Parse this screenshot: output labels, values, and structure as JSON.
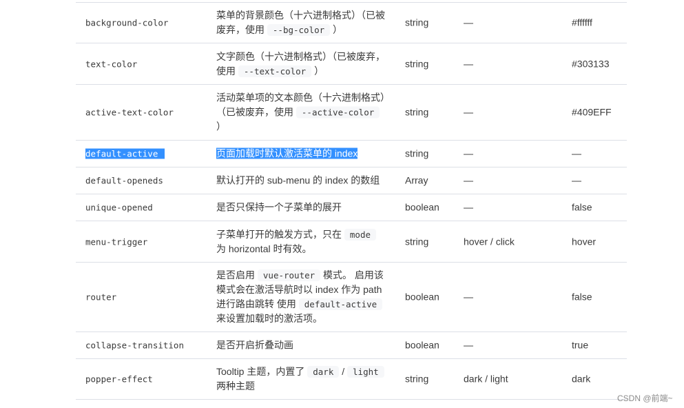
{
  "rows": [
    {
      "name": "background-color",
      "desc": [
        {
          "t": "菜单的背景颜色（十六进制格式）（已被废弃，使用 "
        },
        {
          "c": "--bg-color"
        },
        {
          "t": " ）"
        }
      ],
      "type": "string",
      "options": "—",
      "default": "#ffffff"
    },
    {
      "name": "text-color",
      "desc": [
        {
          "t": "文字颜色（十六进制格式）（已被废弃，使用 "
        },
        {
          "c": "--text-color"
        },
        {
          "t": " ）"
        }
      ],
      "type": "string",
      "options": "—",
      "default": "#303133"
    },
    {
      "name": "active-text-color",
      "desc": [
        {
          "t": "活动菜单项的文本颜色（十六进制格式）（已被废弃，使用 "
        },
        {
          "c": "--active-color"
        },
        {
          "t": " ）"
        }
      ],
      "type": "string",
      "options": "—",
      "default": "#409EFF"
    },
    {
      "name": "default-active",
      "desc": [
        {
          "t": "页面加载时默认激活菜单的 index"
        }
      ],
      "type": "string",
      "options": "—",
      "default": "—",
      "selected": true
    },
    {
      "name": "default-openeds",
      "desc": [
        {
          "t": "默认打开的 sub-menu 的 index 的数组"
        }
      ],
      "type": "Array",
      "options": "—",
      "default": "—"
    },
    {
      "name": "unique-opened",
      "desc": [
        {
          "t": "是否只保持一个子菜单的展开"
        }
      ],
      "type": "boolean",
      "options": "—",
      "default": "false"
    },
    {
      "name": "menu-trigger",
      "desc": [
        {
          "t": "子菜单打开的触发方式，只在 "
        },
        {
          "c": "mode"
        },
        {
          "t": " 为 horizontal 时有效。"
        }
      ],
      "type": "string",
      "options": "hover / click",
      "default": "hover"
    },
    {
      "name": "router",
      "desc": [
        {
          "t": "是否启用 "
        },
        {
          "c": "vue-router"
        },
        {
          "t": " 模式。 启用该模式会在激活导航时以 index 作为 path 进行路由跳转 使用 "
        },
        {
          "c": "default-active"
        },
        {
          "t": " 来设置加载时的激活项。"
        }
      ],
      "type": "boolean",
      "options": "—",
      "default": "false"
    },
    {
      "name": "collapse-transition",
      "desc": [
        {
          "t": "是否开启折叠动画"
        }
      ],
      "type": "boolean",
      "options": "—",
      "default": "true"
    },
    {
      "name": "popper-effect",
      "desc": [
        {
          "t": "Tooltip 主题，内置了 "
        },
        {
          "c": "dark"
        },
        {
          "t": " / "
        },
        {
          "c": "light"
        },
        {
          "t": " 两种主题"
        }
      ],
      "type": "string",
      "options": "dark / light",
      "default": "dark"
    }
  ],
  "watermark": "CSDN @前端~",
  "colors": {
    "selection": "#3390ff",
    "border": "#dcdfe6",
    "code_bg": "#f6f7f9"
  }
}
